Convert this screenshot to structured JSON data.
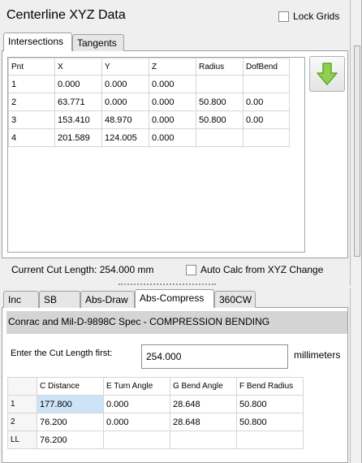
{
  "window": {
    "title": "Centerline XYZ Data",
    "lock_grids_label": "Lock Grids",
    "lock_grids_checked": false
  },
  "top_tabs": [
    {
      "label": "Intersections",
      "active": true
    },
    {
      "label": "Tangents",
      "active": false
    }
  ],
  "intersections": {
    "columns": [
      "Pnt",
      "X",
      "Y",
      "Z",
      "Radius",
      "DofBend"
    ],
    "rows": [
      [
        "1",
        "0.000",
        "0.000",
        "0.000",
        "",
        ""
      ],
      [
        "2",
        "63.771",
        "0.000",
        "0.000",
        "50.800",
        "0.00"
      ],
      [
        "3",
        "153.410",
        "48.970",
        "0.000",
        "50.800",
        "0.00"
      ],
      [
        "4",
        "201.589",
        "124.005",
        "0.000",
        "",
        ""
      ]
    ]
  },
  "action_button": {
    "icon": "down-arrow-icon",
    "color": "#7ec63e"
  },
  "status": {
    "cut_length_label": "Current Cut Length:",
    "cut_length_value": "254.000 mm",
    "auto_calc_label": "Auto Calc from XYZ Change",
    "auto_calc_checked": false
  },
  "bottom_tabs": [
    {
      "label": "Inc",
      "active": false
    },
    {
      "label": "SB",
      "active": false
    },
    {
      "label": "Abs-Draw",
      "active": false
    },
    {
      "label": "Abs-Compress",
      "active": true
    },
    {
      "label": "360CW",
      "active": false
    }
  ],
  "compress": {
    "spec_title": "Conrac and Mil-D-9898C Spec - COMPRESSION BENDING",
    "cut_length_prompt": "Enter the Cut Length first:",
    "cut_length_value": "254.000",
    "units_label": "millimeters",
    "columns": [
      "",
      "C Distance",
      "E Turn Angle",
      "G Bend Angle",
      "F Bend Radius"
    ],
    "rows": [
      [
        "1",
        "177.800",
        "0.000",
        "28.648",
        "50.800"
      ],
      [
        "2",
        "76.200",
        "0.000",
        "28.648",
        "50.800"
      ],
      [
        "LL",
        "76.200",
        "",
        "",
        ""
      ]
    ]
  }
}
